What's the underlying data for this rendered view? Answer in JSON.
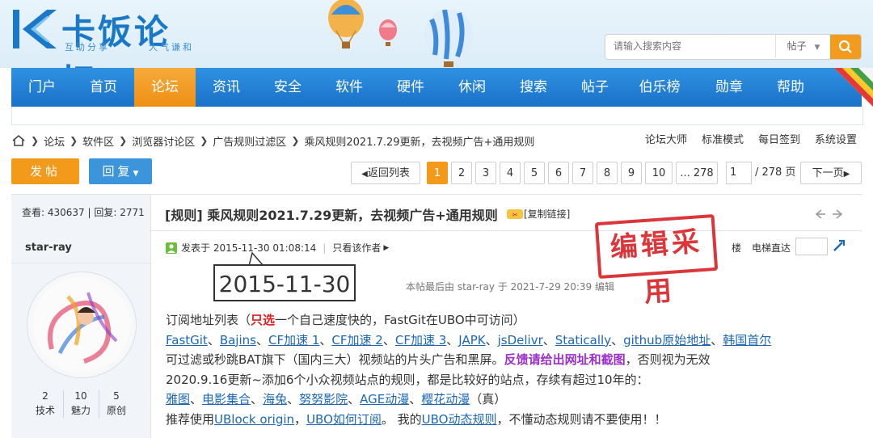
{
  "logo": {
    "title": "卡饭论坛",
    "sub_left": "互助分享",
    "sub_right": "大气谦和"
  },
  "search": {
    "placeholder": "请输入搜索内容",
    "type": "帖子",
    "icon": "search-icon"
  },
  "nav": {
    "items": [
      {
        "label": "门户"
      },
      {
        "label": "首页"
      },
      {
        "label": "论坛",
        "active": true
      },
      {
        "label": "资讯"
      },
      {
        "label": "安全"
      },
      {
        "label": "软件"
      },
      {
        "label": "硬件"
      },
      {
        "label": "休闲"
      },
      {
        "label": "搜索"
      },
      {
        "label": "帖子"
      },
      {
        "label": "伯乐榜"
      },
      {
        "label": "勋章"
      },
      {
        "label": "帮助"
      }
    ]
  },
  "breadcrumb": [
    "论坛",
    "软件区",
    "浏览器讨论区",
    "广告规则过滤区",
    "乘风规则2021.7.29更新，去视频广告+通用规则"
  ],
  "right_links": [
    "论坛大师",
    "标准模式",
    "每日签到",
    "系统设置"
  ],
  "actions": {
    "post": "发帖",
    "reply": "回复"
  },
  "pager": {
    "back": "返回列表",
    "pages": [
      "1",
      "2",
      "3",
      "4",
      "5",
      "6",
      "7",
      "8",
      "9",
      "10",
      "... 278"
    ],
    "current": "1",
    "input_value": "1",
    "total": "/ 278 页",
    "next": "下一页"
  },
  "thread": {
    "stats": "查看: 430637 | 回复: 2771",
    "title": "[规则] 乘风规则2021.7.29更新，去视频广告+通用规则",
    "copy_link": "[复制链接]"
  },
  "author": {
    "name": "star-ray",
    "stats": [
      {
        "value": "2",
        "label": "技术"
      },
      {
        "value": "10",
        "label": "魅力"
      },
      {
        "value": "5",
        "label": "原创"
      }
    ]
  },
  "post": {
    "posted": "发表于 2015-11-30 01:08:14",
    "only_author": "只看该作者",
    "floor": "楼",
    "jump": "电梯直达",
    "stamp": "编辑采用",
    "zoom": "2015-11-30",
    "last_edit": "本帖最后由 star-ray 于 2021-7-29 20:39 编辑"
  },
  "content": {
    "l1_a": "订阅地址列表（",
    "l1_b": "只选",
    "l1_c": "一个自己速度快的，FastGit在UBO中可访问）",
    "links": [
      "FastGit",
      "Bajins",
      "CF加速 1",
      "CF加速 2",
      "CF加速 3",
      "JAPK",
      "jsDelivr",
      "Statically",
      "github原始地址",
      "韩国首尔"
    ],
    "l3_a": "可过滤或秒跳BAT旗下（国内三大）视频站的片头广告和黑屏。",
    "l3_b": "反馈请给出网址和截图",
    "l3_c": "，否则视为无效",
    "l4": "2020.9.16更新~添加6个小众视频站点的规则，都是比较好的站点，存续有超过10年的：",
    "sites": [
      "雅图",
      "电影集合",
      "海兔",
      "努努影院",
      "AGE动漫",
      "樱花动漫"
    ],
    "l5_tail": "（真）",
    "l6_a": "推荐使用",
    "l6_b": "UBlock origin",
    "l6_c": "，",
    "l6_d": "UBO如何订阅",
    "l6_e": "。 我的",
    "l6_f": "UBO动态规则",
    "l6_g": "，不懂动态规则请不要使用！！"
  },
  "colors": {
    "nav_blue": "#1f7bd0",
    "active_orange": "#f29b1d",
    "link_blue": "#1b67b4",
    "red": "#e01f1f",
    "purple": "#9a30c9"
  }
}
